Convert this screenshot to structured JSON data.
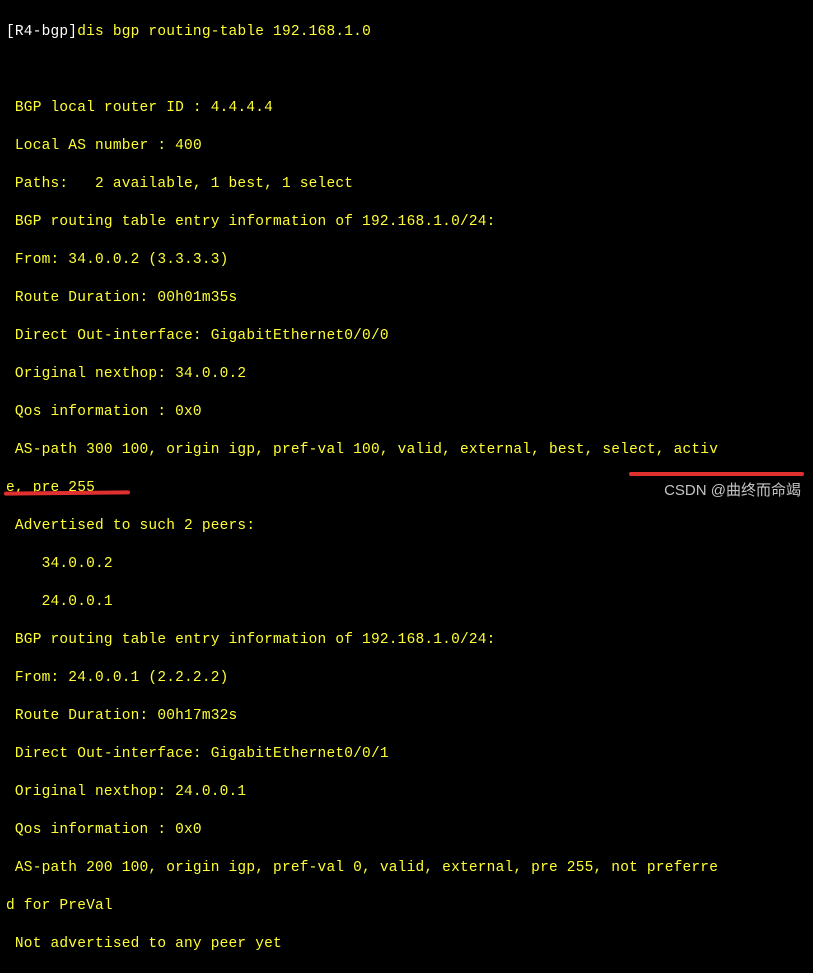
{
  "prompt": {
    "device": "[R4-bgp]",
    "command": "dis bgp routing-table 192.168.1.0"
  },
  "header": {
    "router_id_label": " BGP local router ID : ",
    "router_id": "4.4.4.4",
    "local_as_label": " Local AS number : ",
    "local_as": "400",
    "paths_line": " Paths:   2 available, 1 best, 1 select"
  },
  "entry1": {
    "title": " BGP routing table entry information of 192.168.1.0/24:",
    "from": " From: 34.0.0.2 (3.3.3.3)",
    "duration": " Route Duration: 00h01m35s",
    "out_if": " Direct Out-interface: GigabitEthernet0/0/0",
    "nexthop": " Original nexthop: 34.0.0.2",
    "qos": " Qos information : 0x0",
    "aspath1": " AS-path 300 100, origin igp, pref-val 100, valid, external, best, select, activ",
    "aspath2": "e, pre 255",
    "adv_hdr": " Advertised to such 2 peers:",
    "peer1": "    34.0.0.2",
    "peer2": "    24.0.0.1"
  },
  "entry2": {
    "title": " BGP routing table entry information of 192.168.1.0/24:",
    "from": " From: 24.0.0.1 (2.2.2.2)",
    "duration": " Route Duration: 00h17m32s",
    "out_if": " Direct Out-interface: GigabitEthernet0/0/1",
    "nexthop": " Original nexthop: 24.0.0.1",
    "qos": " Qos information : 0x0",
    "aspath1": " AS-path 200 100, origin igp, pref-val 0, valid, external, pre 255, not preferre",
    "aspath2": "d for PreVal",
    "adv": " Not advertised to any peer yet"
  },
  "watermark": "CSDN @曲终而命竭"
}
